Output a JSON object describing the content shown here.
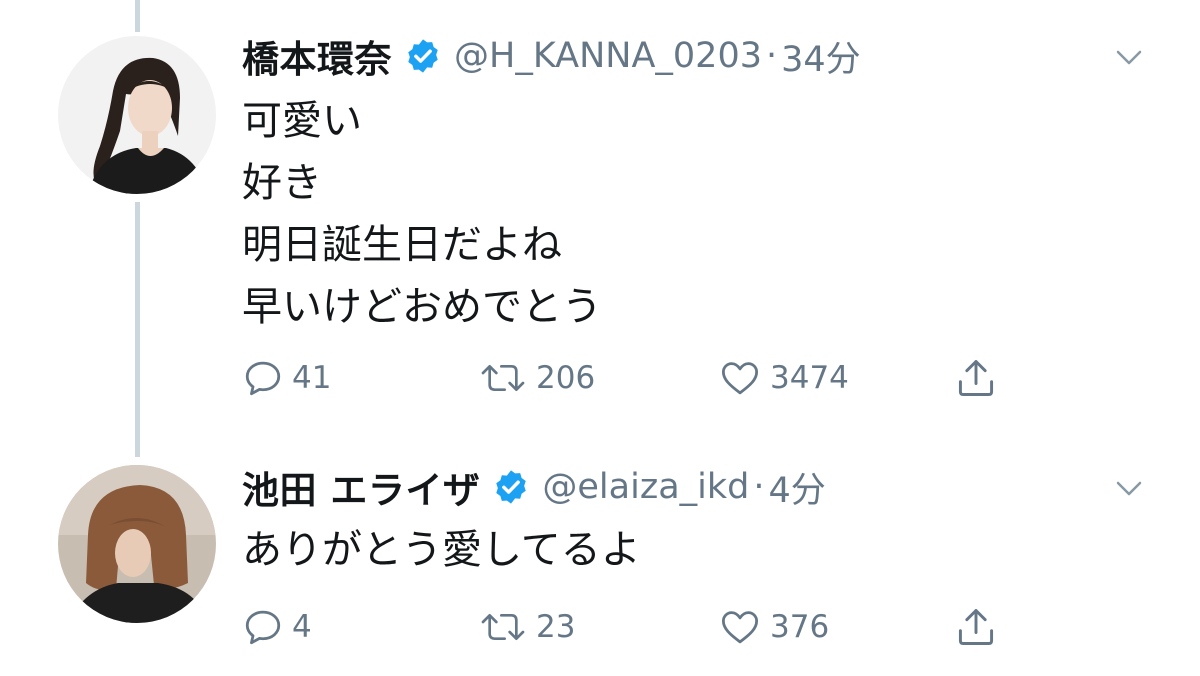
{
  "colors": {
    "text": "#14171a",
    "secondary": "#657786",
    "verified": "#1da1f2",
    "thread_line": "#ccd6dd"
  },
  "tweets": [
    {
      "display_name": "橋本環奈",
      "verified": true,
      "handle": "@H_KANNA_0203",
      "separator": "·",
      "time": "34分",
      "lines": [
        "可愛い",
        "好き",
        "明日誕生日だよね",
        "早いけどおめでとう"
      ],
      "reply_count": "41",
      "retweet_count": "206",
      "like_count": "3474"
    },
    {
      "display_name": "池田 エライザ",
      "verified": true,
      "handle": "@elaiza_ikd",
      "separator": "·",
      "time": "4分",
      "lines": [
        "ありがとう愛してるよ"
      ],
      "reply_count": "4",
      "retweet_count": "23",
      "like_count": "376"
    }
  ],
  "icons": {
    "reply": "reply-icon",
    "retweet": "retweet-icon",
    "like": "heart-icon",
    "share": "share-icon",
    "menu": "chevron-down-icon",
    "verified": "verified-badge-icon"
  }
}
